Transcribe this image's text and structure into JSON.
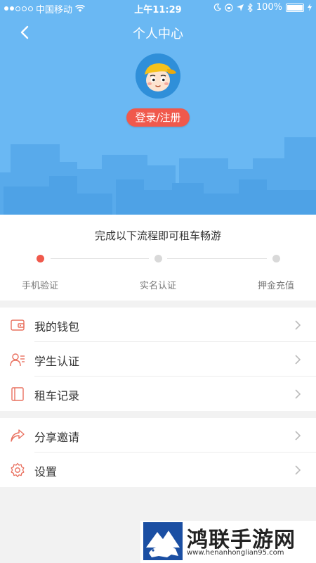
{
  "status_bar": {
    "carrier": "中国移动",
    "time": "上午11:29",
    "battery": "100%"
  },
  "nav": {
    "title": "个人中心"
  },
  "profile": {
    "login_label": "登录/注册"
  },
  "progress": {
    "title": "完成以下流程即可租车畅游",
    "current_step": 1,
    "steps": [
      "手机验证",
      "实名认证",
      "押金充值"
    ]
  },
  "menu_group_1": [
    {
      "label": "我的钱包",
      "icon": "wallet-icon"
    },
    {
      "label": "学生认证",
      "icon": "student-id-icon"
    },
    {
      "label": "租车记录",
      "icon": "record-book-icon"
    }
  ],
  "menu_group_2": [
    {
      "label": "分享邀请",
      "icon": "share-icon"
    },
    {
      "label": "设置",
      "icon": "settings-gear-icon"
    }
  ],
  "watermark": {
    "title": "鸿联手游网",
    "url": "www.henanhonglian95.com"
  },
  "colors": {
    "header_blue": "#6ab8f3",
    "accent_red": "#f0594c",
    "icon_red": "#e9705f"
  }
}
